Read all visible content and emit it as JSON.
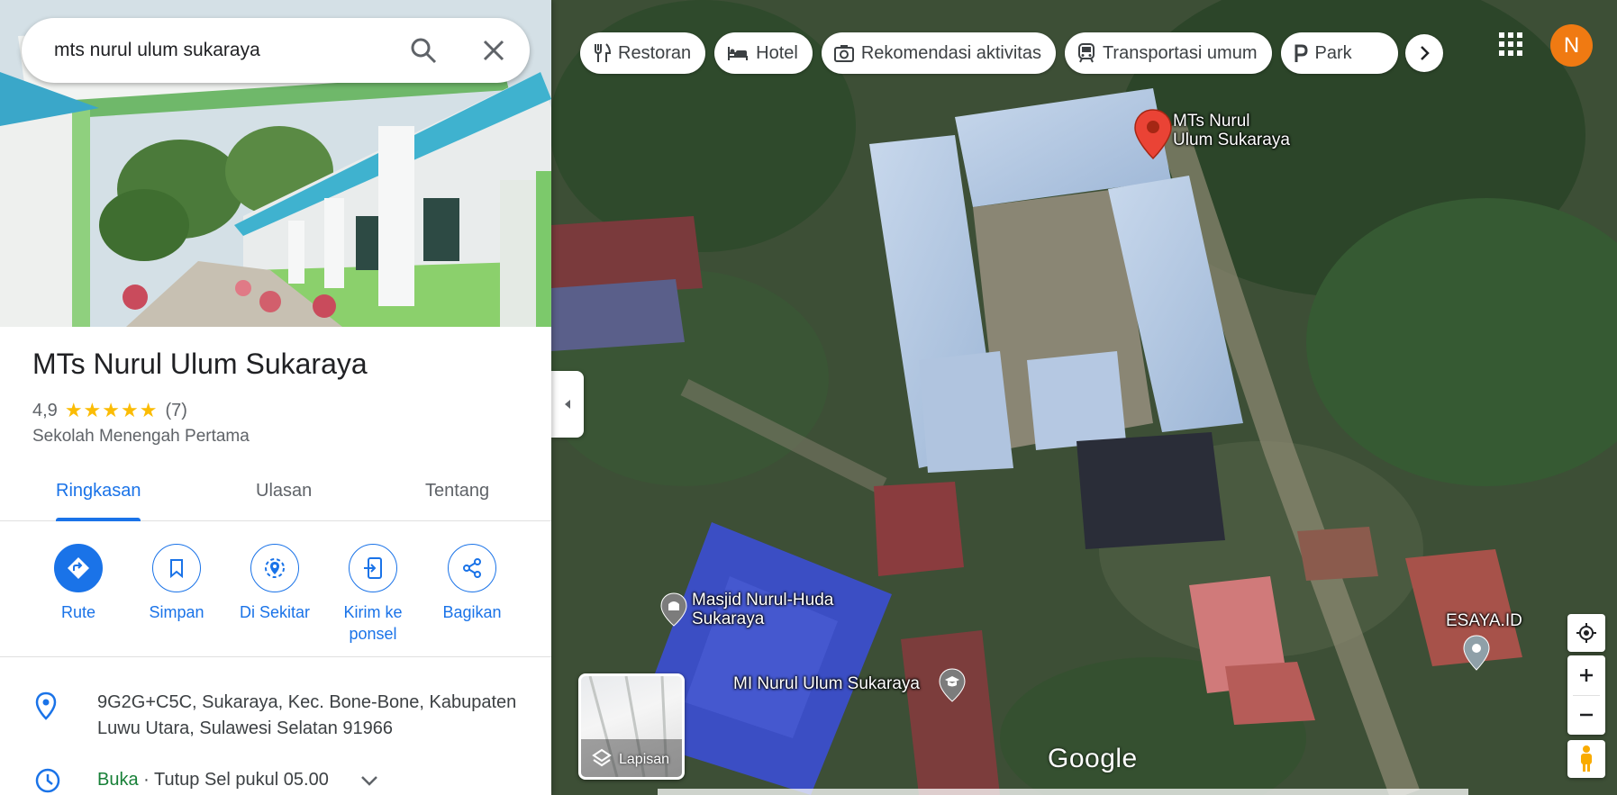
{
  "search": {
    "value": "mts nurul ulum sukaraya",
    "search_icon": "search-icon",
    "clear_icon": "close-icon"
  },
  "place": {
    "title": "MTs Nurul Ulum Sukaraya",
    "rating": "4,9",
    "stars": "★★★★★",
    "rating_value": 4.9,
    "review_count": "(7)",
    "category": "Sekolah Menengah Pertama"
  },
  "tabs": [
    {
      "label": "Ringkasan",
      "active": true
    },
    {
      "label": "Ulasan",
      "active": false
    },
    {
      "label": "Tentang",
      "active": false
    }
  ],
  "actions": [
    {
      "label": "Rute",
      "icon": "directions-icon"
    },
    {
      "label": "Simpan",
      "icon": "bookmark-icon"
    },
    {
      "label": "Di Sekitar",
      "icon": "nearby-icon"
    },
    {
      "label": "Kirim ke ponsel",
      "icon": "send-to-phone-icon"
    },
    {
      "label": "Bagikan",
      "icon": "share-icon"
    }
  ],
  "info": {
    "address": "9G2G+C5C, Sukaraya, Kec. Bone-Bone, Kabupaten Luwu Utara, Sulawesi Selatan 91966",
    "hours_status": "Buka",
    "hours_detail": " · Tutup Sel pukul 05.00"
  },
  "chips": [
    {
      "label": "Restoran",
      "icon": "restaurant-icon"
    },
    {
      "label": "Hotel",
      "icon": "hotel-icon"
    },
    {
      "label": "Rekomendasi aktivitas",
      "icon": "camera-icon"
    },
    {
      "label": "Transportasi umum",
      "icon": "transit-icon"
    },
    {
      "label": "Park",
      "icon": "parking-icon"
    }
  ],
  "user": {
    "avatar_initial": "N"
  },
  "map": {
    "labels": {
      "selected_place": "MTs Nurul\nUlum Sukaraya",
      "mosque": "Masjid Nurul-Huda\nSukaraya",
      "school": "MI Nurul Ulum Sukaraya",
      "esaya": "ESAYA.ID"
    },
    "layers_label": "Lapisan",
    "logo": "Google"
  },
  "colors": {
    "accent": "#1a73e8",
    "open": "#188038",
    "star": "#fbbc04",
    "pin": "#ea4335",
    "avatar": "#f07a12"
  }
}
